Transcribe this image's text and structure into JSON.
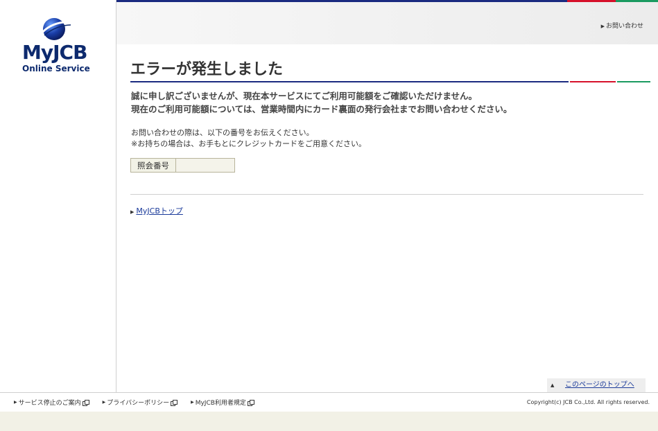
{
  "brand": {
    "logo_main": "MyJCB",
    "logo_sub": "Online Service",
    "colors": {
      "navy": "#1a2a80",
      "red": "#d6102a",
      "green": "#1a9a60"
    }
  },
  "header": {
    "contact_link": "お問い合わせ",
    "contact_icon": "triangle-right-icon"
  },
  "main": {
    "title": "エラーが発生しました",
    "message_line1": "誠に申し訳ございませんが、現在本サービスにてご利用可能額をご確認いただけません。",
    "message_line2": "現在のご利用可能額については、営業時間内にカード裏面の発行会社までお問い合わせください。",
    "note_line1": "お問い合わせの際は、以下の番号をお伝えください。",
    "note_line2": "※お持ちの場合は、お手もとにクレジットカードをご用意ください。",
    "reference": {
      "label": "照会番号",
      "value": ""
    },
    "top_link": "MyJCBトップ"
  },
  "page_top": {
    "label": "このページのトップへ",
    "icon": "triangle-up-icon"
  },
  "footer": {
    "links": [
      {
        "label": "サービス停止のご案内",
        "icon": "external-window-icon"
      },
      {
        "label": "プライバシーポリシー",
        "icon": "external-window-icon"
      },
      {
        "label": "MyJCB利用者規定",
        "icon": "external-window-icon"
      }
    ],
    "copyright": "Copyright(c) JCB Co.,Ltd. All rights reserved."
  }
}
